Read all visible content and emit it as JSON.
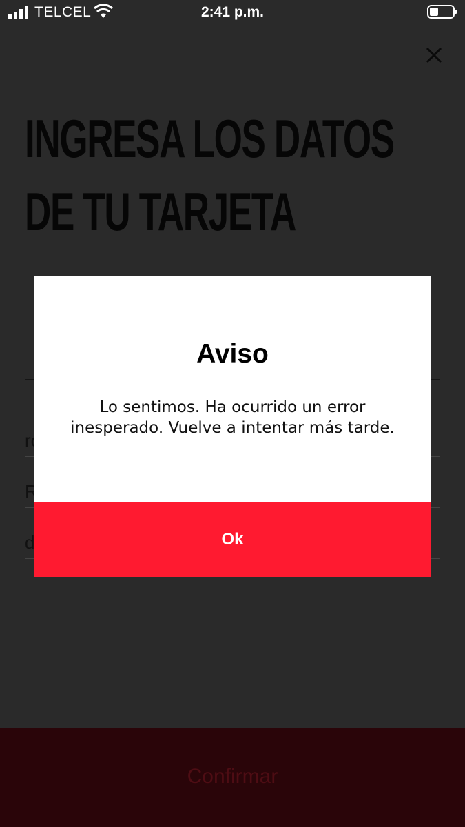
{
  "status_bar": {
    "carrier": "TELCEL",
    "time": "2:41 p.m."
  },
  "page": {
    "title": "INGRESA LOS DATOS\nDE TU TARJETA",
    "fields": [
      "ro",
      "R",
      "d"
    ]
  },
  "modal": {
    "title": "Aviso",
    "message": "Lo sentimos. Ha ocurrido un error inesperado. Vuelve a intentar más tarde.",
    "ok_label": "Ok"
  },
  "footer": {
    "confirm_label": "Confirmar"
  },
  "colors": {
    "accent": "#ff1a30",
    "confirm_dim": "#2a0509",
    "overlay_bg": "#2a2a2a"
  },
  "icons": [
    "signal-icon",
    "wifi-icon",
    "battery-icon",
    "close-icon"
  ]
}
